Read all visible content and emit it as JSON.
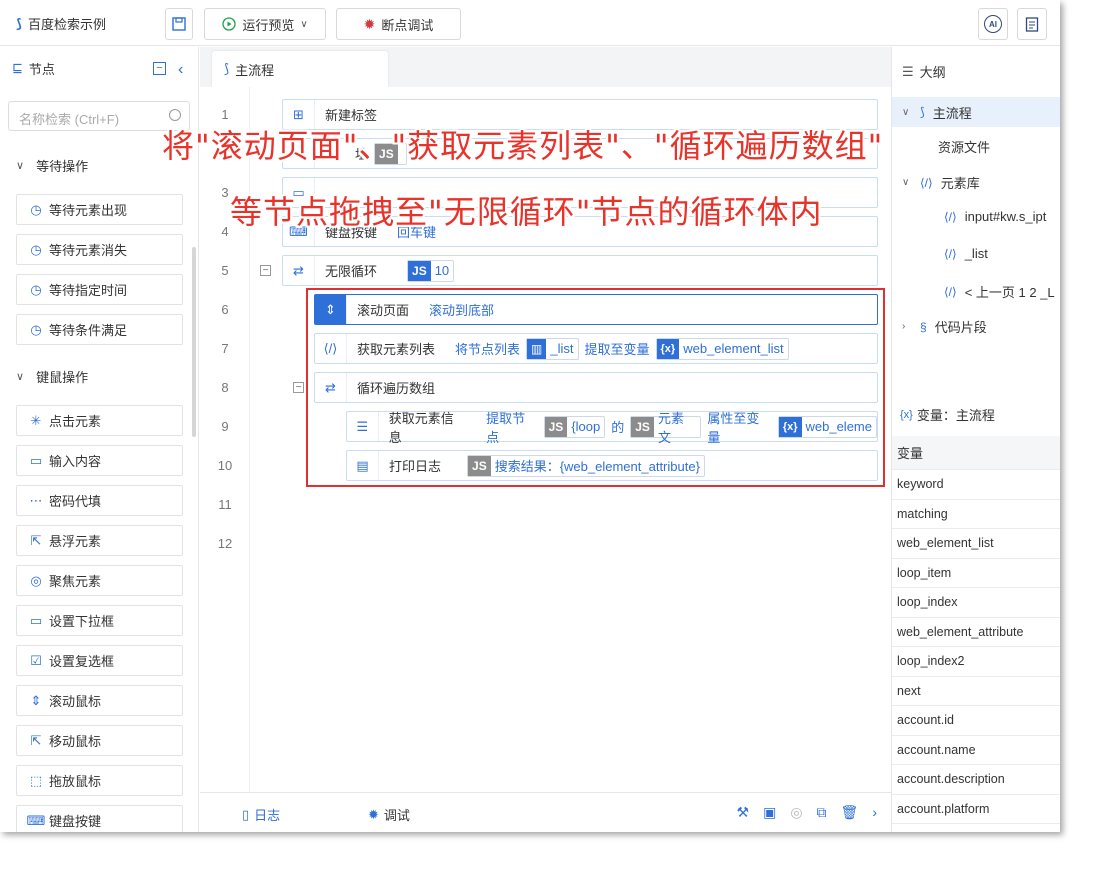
{
  "app": {
    "title": "百度检索示例"
  },
  "toolbar": {
    "run_label": "运行预览",
    "debug_label": "断点调试",
    "ai_label": "AI"
  },
  "left": {
    "title": "节点",
    "search_placeholder": "名称检索 (Ctrl+F)",
    "groups": [
      {
        "label": "等待操作",
        "items": [
          "等待元素出现",
          "等待元素消失",
          "等待指定时间",
          "等待条件满足"
        ]
      },
      {
        "label": "键鼠操作",
        "items": [
          "点击元素",
          "输入内容",
          "密码代填",
          "悬浮元素",
          "聚焦元素",
          "设置下拉框",
          "设置复选框",
          "滚动鼠标",
          "移动鼠标",
          "拖放鼠标",
          "键盘按键"
        ]
      }
    ]
  },
  "center": {
    "tab": "主流程",
    "lines": [
      "1",
      "2",
      "3",
      "4",
      "5",
      "6",
      "7",
      "8",
      "9",
      "10",
      "11",
      "12"
    ],
    "rows": {
      "r1": {
        "title": "新建标签"
      },
      "r2": {
        "title": "址"
      },
      "r4": {
        "title": "键盘按键",
        "desc": "回车键"
      },
      "r5": {
        "title": "无限循环",
        "chip": "10"
      },
      "r6": {
        "title": "滚动页面",
        "desc": "滚动到底部"
      },
      "r7": {
        "title": "获取元素列表",
        "desc": "将节点列表",
        "chip1": "_list",
        "mid": "提取至变量",
        "chip2": "web_element_list"
      },
      "r8": {
        "title": "循环遍历数组"
      },
      "r9": {
        "title": "获取元素信息",
        "desc": "提取节点",
        "chip1": "{loop",
        "mid1": "的",
        "chip2": "元素文",
        "mid2": "属性至变量",
        "chip3": "web_eleme"
      },
      "r10": {
        "title": "打印日志",
        "chip": "搜索结果：{web_element_attribute}"
      }
    },
    "annotation_line1": "将\"滚动页面\"、\"获取元素列表\"、\"循环遍历数组\"",
    "annotation_line2": "等节点拖拽至\"无限循环\"节点的循环体内",
    "bottom_tabs": {
      "log": "日志",
      "debug": "调试"
    }
  },
  "right": {
    "outline_title": "大纲",
    "tree": {
      "main": "主流程",
      "resources": "资源文件",
      "elements": "元素库",
      "el1": "input#kw.s_ipt",
      "el2": "_list",
      "el3": "< 上一页 1 2 _L",
      "snippets": "代码片段"
    },
    "vars_title": "变量：主流程",
    "vars_header": "变量",
    "variables": [
      "keyword",
      "matching",
      "web_element_list",
      "loop_item",
      "loop_index",
      "web_element_attribute",
      "loop_index2",
      "next",
      "account.id",
      "account.name",
      "account.description",
      "account.platform"
    ]
  },
  "colors": {
    "accent": "#2f6fd8",
    "annotation": "#e8332b",
    "highlight_box": "#e03131"
  }
}
